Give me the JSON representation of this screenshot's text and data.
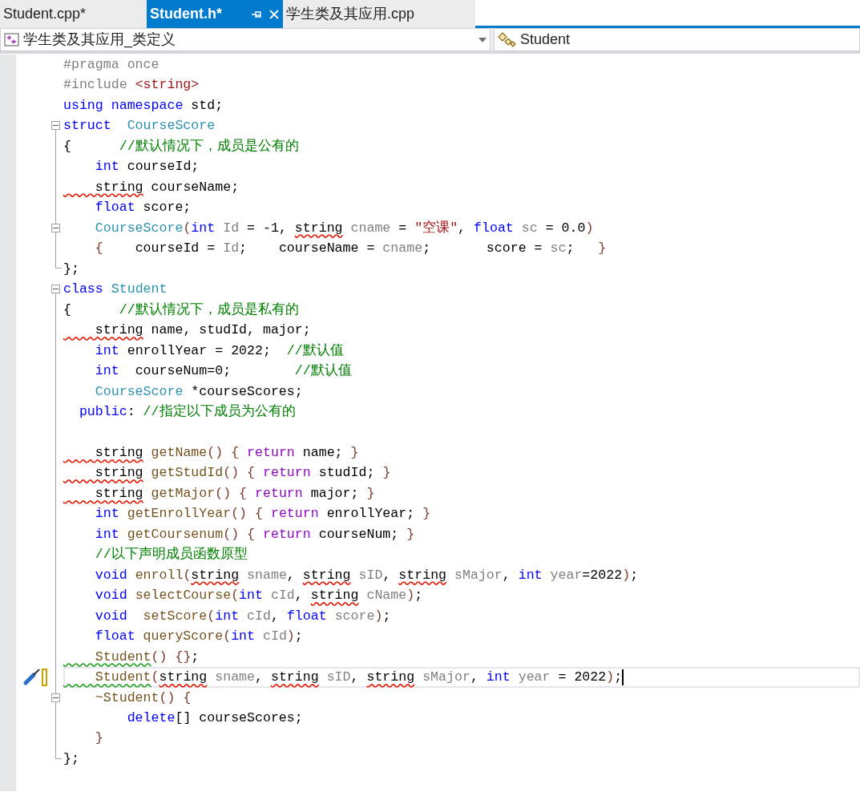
{
  "tabs": [
    {
      "label": "Student.cpp*",
      "selected": false
    },
    {
      "label": "Student.h*",
      "selected": true
    },
    {
      "label": "学生类及其应用.cpp",
      "selected": false
    }
  ],
  "navigation": {
    "project": "学生类及其应用_类定义",
    "scope": "Student"
  },
  "lines": [
    {
      "collapsible": false,
      "guide": false,
      "block_end": false,
      "tokens": [
        {
          "text": "#pragma once",
          "kind": "preprocessor"
        }
      ]
    },
    {
      "collapsible": false,
      "guide": false,
      "block_end": false,
      "tokens": [
        {
          "text": "#include ",
          "kind": "preprocessor"
        },
        {
          "text": "<string>",
          "kind": "string"
        }
      ]
    },
    {
      "collapsible": false,
      "guide": false,
      "block_end": false,
      "tokens": [
        {
          "text": "using namespace",
          "kind": "keyword"
        },
        {
          "text": " std;",
          "kind": "plain"
        }
      ]
    },
    {
      "collapsible": true,
      "guide": true,
      "block_end": false,
      "tokens": [
        {
          "text": "struct",
          "kind": "keyword"
        },
        {
          "text": "  CourseScore",
          "kind": "type"
        }
      ]
    },
    {
      "collapsible": false,
      "guide": true,
      "block_end": false,
      "tokens": [
        {
          "text": "{      ",
          "kind": "plain"
        },
        {
          "text": "//默认情况下，成员是公有的",
          "kind": "comment"
        }
      ]
    },
    {
      "collapsible": false,
      "guide": true,
      "block_end": false,
      "tokens": [
        {
          "text": "    int",
          "kind": "keyword"
        },
        {
          "text": " courseId;",
          "kind": "plain"
        }
      ]
    },
    {
      "collapsible": false,
      "guide": true,
      "block_end": false,
      "tokens": [
        {
          "text": "    string",
          "kind": "plain",
          "error": true
        },
        {
          "text": " courseName;",
          "kind": "plain"
        }
      ]
    },
    {
      "collapsible": false,
      "guide": true,
      "block_end": false,
      "tokens": [
        {
          "text": "    float",
          "kind": "keyword"
        },
        {
          "text": " score;",
          "kind": "plain"
        }
      ]
    },
    {
      "collapsible": true,
      "guide": true,
      "block_end": false,
      "tokens": [
        {
          "text": "    CourseScore",
          "kind": "type"
        },
        {
          "text": "(",
          "kind": "brace"
        },
        {
          "text": "int",
          "kind": "keyword"
        },
        {
          "text": " Id",
          "kind": "parameter"
        },
        {
          "text": " = -1, ",
          "kind": "plain"
        },
        {
          "text": "string",
          "kind": "plain",
          "error": true
        },
        {
          "text": " cname",
          "kind": "parameter"
        },
        {
          "text": " = ",
          "kind": "plain"
        },
        {
          "text": "\"空课\"",
          "kind": "string"
        },
        {
          "text": ", ",
          "kind": "plain"
        },
        {
          "text": "float",
          "kind": "keyword"
        },
        {
          "text": " sc",
          "kind": "parameter"
        },
        {
          "text": " = 0.0",
          "kind": "plain"
        },
        {
          "text": ")",
          "kind": "brace"
        }
      ]
    },
    {
      "collapsible": false,
      "guide": true,
      "block_end": false,
      "tokens": [
        {
          "text": "    {",
          "kind": "brace"
        },
        {
          "text": "    courseId = ",
          "kind": "plain"
        },
        {
          "text": "Id",
          "kind": "parameter"
        },
        {
          "text": ";    courseName = ",
          "kind": "plain"
        },
        {
          "text": "cname",
          "kind": "parameter"
        },
        {
          "text": ";       score = ",
          "kind": "plain"
        },
        {
          "text": "sc",
          "kind": "parameter"
        },
        {
          "text": ";   ",
          "kind": "plain"
        },
        {
          "text": "}",
          "kind": "brace"
        }
      ]
    },
    {
      "collapsible": false,
      "guide": false,
      "block_end": true,
      "tokens": [
        {
          "text": "};",
          "kind": "plain"
        }
      ]
    },
    {
      "collapsible": true,
      "guide": true,
      "block_end": false,
      "tokens": [
        {
          "text": "class",
          "kind": "keyword"
        },
        {
          "text": " Student",
          "kind": "type"
        }
      ]
    },
    {
      "collapsible": false,
      "guide": true,
      "block_end": false,
      "tokens": [
        {
          "text": "{      ",
          "kind": "plain"
        },
        {
          "text": "//默认情况下，成员是私有的",
          "kind": "comment"
        }
      ]
    },
    {
      "collapsible": false,
      "guide": true,
      "block_end": false,
      "tokens": [
        {
          "text": "    string",
          "kind": "plain",
          "error": true
        },
        {
          "text": " name, studId, major;",
          "kind": "plain"
        }
      ]
    },
    {
      "collapsible": false,
      "guide": true,
      "block_end": false,
      "tokens": [
        {
          "text": "    int",
          "kind": "keyword"
        },
        {
          "text": " enrollYear = 2022;  ",
          "kind": "plain"
        },
        {
          "text": "//默认值",
          "kind": "comment"
        }
      ]
    },
    {
      "collapsible": false,
      "guide": true,
      "block_end": false,
      "tokens": [
        {
          "text": "    int",
          "kind": "keyword"
        },
        {
          "text": "  courseNum=0;        ",
          "kind": "plain"
        },
        {
          "text": "//默认值",
          "kind": "comment"
        }
      ]
    },
    {
      "collapsible": false,
      "guide": true,
      "block_end": false,
      "tokens": [
        {
          "text": "    CourseScore",
          "kind": "type"
        },
        {
          "text": " *courseScores;",
          "kind": "plain"
        }
      ]
    },
    {
      "collapsible": false,
      "guide": true,
      "block_end": false,
      "tokens": [
        {
          "text": "  public",
          "kind": "keyword"
        },
        {
          "text": ": ",
          "kind": "plain"
        },
        {
          "text": "//指定以下成员为公有的",
          "kind": "comment"
        }
      ]
    },
    {
      "collapsible": false,
      "guide": true,
      "block_end": false
    },
    {
      "collapsible": false,
      "guide": true,
      "block_end": false,
      "tokens": [
        {
          "text": "    string",
          "kind": "plain",
          "error": true
        },
        {
          "text": " getName",
          "kind": "function"
        },
        {
          "text": "()",
          "kind": "brace"
        },
        {
          "text": " {",
          "kind": "brace"
        },
        {
          "text": " return",
          "kind": "control"
        },
        {
          "text": " name; ",
          "kind": "plain"
        },
        {
          "text": "}",
          "kind": "brace"
        }
      ]
    },
    {
      "collapsible": false,
      "guide": true,
      "block_end": false,
      "tokens": [
        {
          "text": "    string",
          "kind": "plain",
          "error": true
        },
        {
          "text": " getStudId",
          "kind": "function"
        },
        {
          "text": "()",
          "kind": "brace"
        },
        {
          "text": " {",
          "kind": "brace"
        },
        {
          "text": " return",
          "kind": "control"
        },
        {
          "text": " studId; ",
          "kind": "plain"
        },
        {
          "text": "}",
          "kind": "brace"
        }
      ]
    },
    {
      "collapsible": false,
      "guide": true,
      "block_end": false,
      "tokens": [
        {
          "text": "    string",
          "kind": "plain",
          "error": true
        },
        {
          "text": " getMajor",
          "kind": "function"
        },
        {
          "text": "()",
          "kind": "brace"
        },
        {
          "text": " {",
          "kind": "brace"
        },
        {
          "text": " return",
          "kind": "control"
        },
        {
          "text": " major; ",
          "kind": "plain"
        },
        {
          "text": "}",
          "kind": "brace"
        }
      ]
    },
    {
      "collapsible": false,
      "guide": true,
      "block_end": false,
      "tokens": [
        {
          "text": "    int",
          "kind": "keyword"
        },
        {
          "text": " getEnrollYear",
          "kind": "function"
        },
        {
          "text": "()",
          "kind": "brace"
        },
        {
          "text": " {",
          "kind": "brace"
        },
        {
          "text": " return",
          "kind": "control"
        },
        {
          "text": " enrollYear; ",
          "kind": "plain"
        },
        {
          "text": "}",
          "kind": "brace"
        }
      ]
    },
    {
      "collapsible": false,
      "guide": true,
      "block_end": false,
      "tokens": [
        {
          "text": "    int",
          "kind": "keyword"
        },
        {
          "text": " getCoursenum",
          "kind": "function"
        },
        {
          "text": "()",
          "kind": "brace"
        },
        {
          "text": " {",
          "kind": "brace"
        },
        {
          "text": " return",
          "kind": "control"
        },
        {
          "text": " courseNum; ",
          "kind": "plain"
        },
        {
          "text": "}",
          "kind": "brace"
        }
      ]
    },
    {
      "collapsible": false,
      "guide": true,
      "block_end": false,
      "tokens": [
        {
          "text": "    //以下声明成员函数原型",
          "kind": "comment"
        }
      ]
    },
    {
      "collapsible": false,
      "guide": true,
      "block_end": false,
      "tokens": [
        {
          "text": "    void",
          "kind": "keyword"
        },
        {
          "text": " enroll",
          "kind": "function"
        },
        {
          "text": "(",
          "kind": "brace"
        },
        {
          "text": "string",
          "kind": "plain",
          "error": true
        },
        {
          "text": " sname",
          "kind": "parameter"
        },
        {
          "text": ", ",
          "kind": "plain"
        },
        {
          "text": "string",
          "kind": "plain",
          "error": true
        },
        {
          "text": " sID",
          "kind": "parameter"
        },
        {
          "text": ", ",
          "kind": "plain"
        },
        {
          "text": "string",
          "kind": "plain",
          "error": true
        },
        {
          "text": " sMajor",
          "kind": "parameter"
        },
        {
          "text": ", ",
          "kind": "plain"
        },
        {
          "text": "int",
          "kind": "keyword"
        },
        {
          "text": " year",
          "kind": "parameter"
        },
        {
          "text": "=2022",
          "kind": "plain"
        },
        {
          "text": ")",
          "kind": "brace"
        },
        {
          "text": ";",
          "kind": "plain"
        }
      ]
    },
    {
      "collapsible": false,
      "guide": true,
      "block_end": false,
      "tokens": [
        {
          "text": "    void",
          "kind": "keyword"
        },
        {
          "text": " selectCourse",
          "kind": "function"
        },
        {
          "text": "(",
          "kind": "brace"
        },
        {
          "text": "int",
          "kind": "keyword"
        },
        {
          "text": " cId",
          "kind": "parameter"
        },
        {
          "text": ", ",
          "kind": "plain"
        },
        {
          "text": "string",
          "kind": "plain",
          "error": true
        },
        {
          "text": " cName",
          "kind": "parameter"
        },
        {
          "text": ")",
          "kind": "brace"
        },
        {
          "text": ";",
          "kind": "plain"
        }
      ]
    },
    {
      "collapsible": false,
      "guide": true,
      "block_end": false,
      "tokens": [
        {
          "text": "    void",
          "kind": "keyword"
        },
        {
          "text": "  setScore",
          "kind": "function"
        },
        {
          "text": "(",
          "kind": "brace"
        },
        {
          "text": "int",
          "kind": "keyword"
        },
        {
          "text": " cId",
          "kind": "parameter"
        },
        {
          "text": ", ",
          "kind": "plain"
        },
        {
          "text": "float",
          "kind": "keyword"
        },
        {
          "text": " score",
          "kind": "parameter"
        },
        {
          "text": ")",
          "kind": "brace"
        },
        {
          "text": ";",
          "kind": "plain"
        }
      ]
    },
    {
      "collapsible": false,
      "guide": true,
      "block_end": false,
      "tokens": [
        {
          "text": "    float",
          "kind": "keyword"
        },
        {
          "text": " queryScore",
          "kind": "function"
        },
        {
          "text": "(",
          "kind": "brace"
        },
        {
          "text": "int",
          "kind": "keyword"
        },
        {
          "text": " cId",
          "kind": "parameter"
        },
        {
          "text": ")",
          "kind": "brace"
        },
        {
          "text": ";",
          "kind": "plain"
        }
      ]
    },
    {
      "collapsible": false,
      "guide": true,
      "block_end": false,
      "tokens": [
        {
          "text": "    Student",
          "kind": "function",
          "warning": true
        },
        {
          "text": "()",
          "kind": "brace"
        },
        {
          "text": " {}",
          "kind": "brace"
        },
        {
          "text": ";",
          "kind": "plain"
        }
      ]
    },
    {
      "collapsible": false,
      "guide": true,
      "block_end": false,
      "current": true,
      "quick_actions": true,
      "tokens": [
        {
          "text": "    Student",
          "kind": "function",
          "warning": true
        },
        {
          "text": "(",
          "kind": "brace"
        },
        {
          "text": "string",
          "kind": "plain",
          "error": true
        },
        {
          "text": " sname",
          "kind": "parameter"
        },
        {
          "text": ", ",
          "kind": "plain"
        },
        {
          "text": "string",
          "kind": "plain",
          "error": true
        },
        {
          "text": " sID",
          "kind": "parameter"
        },
        {
          "text": ", ",
          "kind": "plain"
        },
        {
          "text": "string",
          "kind": "plain",
          "error": true
        },
        {
          "text": " sMajor",
          "kind": "parameter"
        },
        {
          "text": ", ",
          "kind": "plain"
        },
        {
          "text": "int",
          "kind": "keyword"
        },
        {
          "text": " year",
          "kind": "parameter"
        },
        {
          "text": " = 2022",
          "kind": "plain"
        },
        {
          "text": ")",
          "kind": "brace"
        },
        {
          "text": ";",
          "kind": "plain"
        }
      ]
    },
    {
      "collapsible": true,
      "guide": true,
      "block_end": false,
      "tokens": [
        {
          "text": "    ~Student",
          "kind": "function"
        },
        {
          "text": "()",
          "kind": "brace"
        },
        {
          "text": " {",
          "kind": "brace"
        }
      ]
    },
    {
      "collapsible": false,
      "guide": true,
      "block_end": false,
      "tokens": [
        {
          "text": "        delete",
          "kind": "keyword"
        },
        {
          "text": "[] courseScores;",
          "kind": "plain"
        }
      ]
    },
    {
      "collapsible": false,
      "guide": true,
      "block_end": false,
      "tokens": [
        {
          "text": "    }",
          "kind": "brace"
        }
      ]
    },
    {
      "collapsible": false,
      "guide": false,
      "block_end": true,
      "tokens": [
        {
          "text": "};",
          "kind": "plain"
        }
      ]
    }
  ]
}
